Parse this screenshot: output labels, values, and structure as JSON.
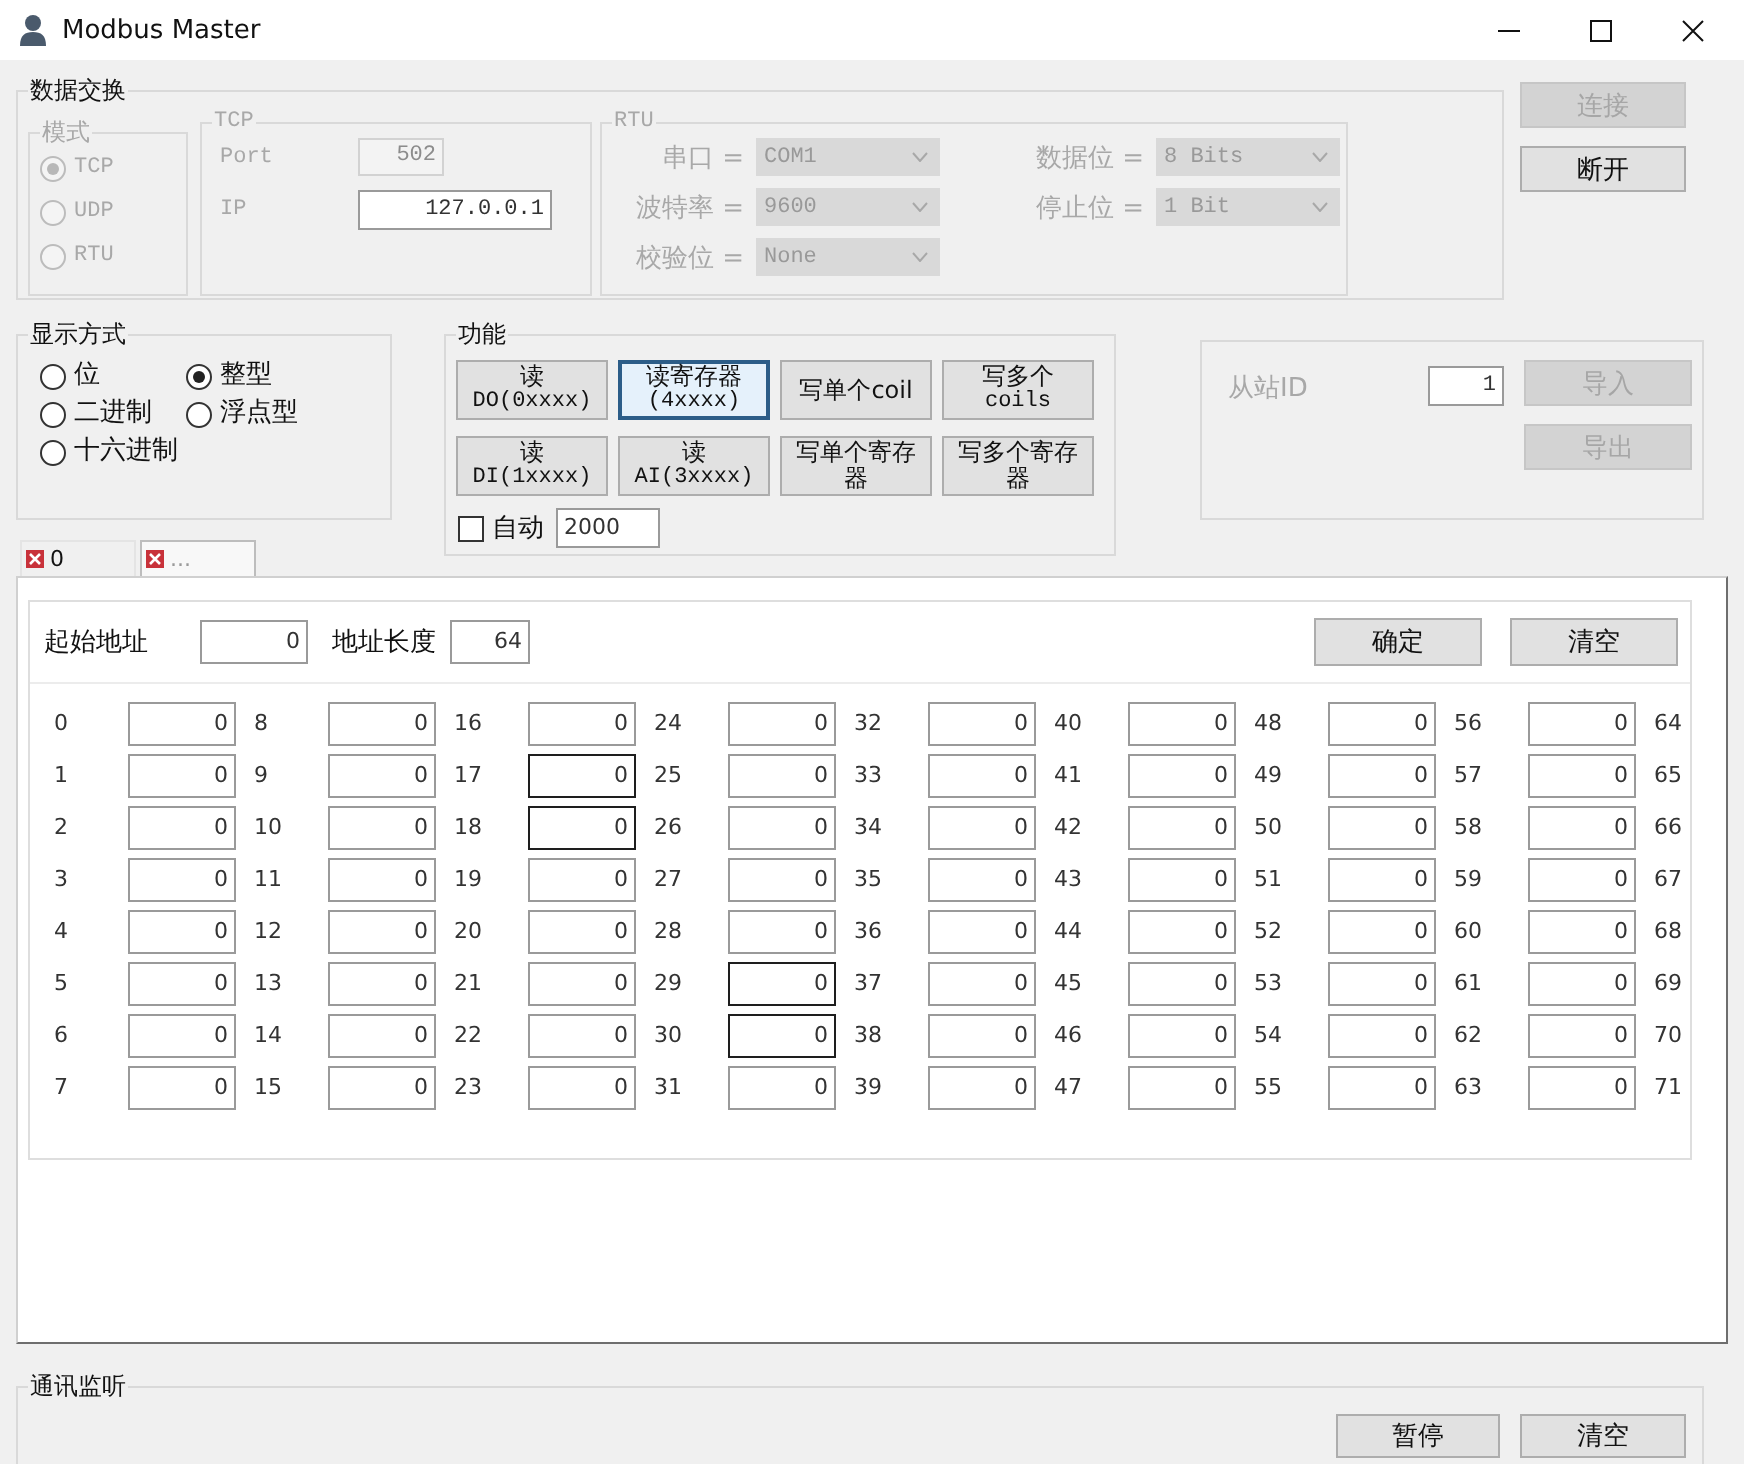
{
  "window": {
    "title": "Modbus Master"
  },
  "data_exchange": {
    "title": "数据交换",
    "mode": {
      "title": "模式",
      "disabled": true,
      "options": [
        {
          "label": "TCP",
          "selected": true
        },
        {
          "label": "UDP",
          "selected": false
        },
        {
          "label": "RTU",
          "selected": false
        }
      ]
    },
    "tcp": {
      "title": "TCP",
      "disabled": true,
      "fields": [
        {
          "label": "Port",
          "value": "502",
          "disabled": true
        },
        {
          "label": "IP",
          "value": "127.0.0.1",
          "disabled": false
        }
      ]
    },
    "rtu": {
      "title": "RTU",
      "disabled": true,
      "fields": [
        {
          "label": "串口 =",
          "value": "COM1"
        },
        {
          "label": "数据位 =",
          "value": "8 Bits"
        },
        {
          "label": "波特率 =",
          "value": "9600"
        },
        {
          "label": "停止位 =",
          "value": "1 Bit"
        },
        {
          "label": "校验位 =",
          "value": "None"
        }
      ]
    },
    "buttons": [
      {
        "label": "连接",
        "disabled": true
      },
      {
        "label": "断开",
        "disabled": false
      }
    ]
  },
  "display_mode": {
    "title": "显示方式",
    "options": [
      {
        "label": "位",
        "selected": false
      },
      {
        "label": "整型",
        "selected": true
      },
      {
        "label": "二进制",
        "selected": false
      },
      {
        "label": "浮点型",
        "selected": false
      },
      {
        "label": "十六进制",
        "selected": false
      }
    ]
  },
  "functions": {
    "title": "功能",
    "buttons": [
      {
        "lines": [
          "读",
          "DO(0xxxx)"
        ],
        "selected": false
      },
      {
        "lines": [
          "读寄存器",
          "(4xxxx)"
        ],
        "selected": true
      },
      {
        "lines": [
          "写单个coil"
        ],
        "selected": false
      },
      {
        "lines": [
          "写多个",
          "coils"
        ],
        "selected": false
      },
      {
        "lines": [
          "读",
          "DI(1xxxx)"
        ],
        "selected": false
      },
      {
        "lines": [
          "读",
          "AI(3xxxx)"
        ],
        "selected": false
      },
      {
        "lines": [
          "写单个寄存器"
        ],
        "selected": false
      },
      {
        "lines": [
          "写多个寄存器"
        ],
        "selected": false
      }
    ],
    "auto": {
      "label": "自动",
      "checked": false
    },
    "interval": "2000"
  },
  "slave": {
    "label": "从站ID",
    "disabled": true,
    "value": "1",
    "buttons": [
      {
        "label": "导入",
        "disabled": true
      },
      {
        "label": "导出",
        "disabled": true
      }
    ]
  },
  "tabs": [
    {
      "label": "0",
      "selected": true
    },
    {
      "label": "...",
      "selected": false
    }
  ],
  "registers": {
    "start_label": "起始地址",
    "start": "0",
    "length_label": "地址长度",
    "length": "64",
    "buttons": [
      {
        "label": "确定"
      },
      {
        "label": "清空"
      }
    ],
    "rows": [
      {
        "labels": [
          "0",
          "8",
          "16",
          "24",
          "32",
          "40",
          "48",
          "56",
          "64"
        ],
        "cells": [
          {
            "value": "0",
            "outlined": false
          },
          {
            "value": "0",
            "outlined": false
          },
          {
            "value": "0",
            "outlined": false
          },
          {
            "value": "0",
            "outlined": false
          },
          {
            "value": "0",
            "outlined": false
          },
          {
            "value": "0",
            "outlined": false
          },
          {
            "value": "0",
            "outlined": false
          },
          {
            "value": "0",
            "outlined": false
          }
        ]
      },
      {
        "labels": [
          "1",
          "9",
          "17",
          "25",
          "33",
          "41",
          "49",
          "57",
          "65"
        ],
        "cells": [
          {
            "value": "0",
            "outlined": false
          },
          {
            "value": "0",
            "outlined": false
          },
          {
            "value": "0",
            "outlined": true
          },
          {
            "value": "0",
            "outlined": false
          },
          {
            "value": "0",
            "outlined": false
          },
          {
            "value": "0",
            "outlined": false
          },
          {
            "value": "0",
            "outlined": false
          },
          {
            "value": "0",
            "outlined": false
          }
        ]
      },
      {
        "labels": [
          "2",
          "10",
          "18",
          "26",
          "34",
          "42",
          "50",
          "58",
          "66"
        ],
        "cells": [
          {
            "value": "0",
            "outlined": false
          },
          {
            "value": "0",
            "outlined": false
          },
          {
            "value": "0",
            "outlined": true
          },
          {
            "value": "0",
            "outlined": false
          },
          {
            "value": "0",
            "outlined": false
          },
          {
            "value": "0",
            "outlined": false
          },
          {
            "value": "0",
            "outlined": false
          },
          {
            "value": "0",
            "outlined": false
          }
        ]
      },
      {
        "labels": [
          "3",
          "11",
          "19",
          "27",
          "35",
          "43",
          "51",
          "59",
          "67"
        ],
        "cells": [
          {
            "value": "0",
            "outlined": false
          },
          {
            "value": "0",
            "outlined": false
          },
          {
            "value": "0",
            "outlined": false
          },
          {
            "value": "0",
            "outlined": false
          },
          {
            "value": "0",
            "outlined": false
          },
          {
            "value": "0",
            "outlined": false
          },
          {
            "value": "0",
            "outlined": false
          },
          {
            "value": "0",
            "outlined": false
          }
        ]
      },
      {
        "labels": [
          "4",
          "12",
          "20",
          "28",
          "36",
          "44",
          "52",
          "60",
          "68"
        ],
        "cells": [
          {
            "value": "0",
            "outlined": false
          },
          {
            "value": "0",
            "outlined": false
          },
          {
            "value": "0",
            "outlined": false
          },
          {
            "value": "0",
            "outlined": false
          },
          {
            "value": "0",
            "outlined": false
          },
          {
            "value": "0",
            "outlined": false
          },
          {
            "value": "0",
            "outlined": false
          },
          {
            "value": "0",
            "outlined": false
          }
        ]
      },
      {
        "labels": [
          "5",
          "13",
          "21",
          "29",
          "37",
          "45",
          "53",
          "61",
          "69"
        ],
        "cells": [
          {
            "value": "0",
            "outlined": false
          },
          {
            "value": "0",
            "outlined": false
          },
          {
            "value": "0",
            "outlined": false
          },
          {
            "value": "0",
            "outlined": true
          },
          {
            "value": "0",
            "outlined": false
          },
          {
            "value": "0",
            "outlined": false
          },
          {
            "value": "0",
            "outlined": false
          },
          {
            "value": "0",
            "outlined": false
          }
        ]
      },
      {
        "labels": [
          "6",
          "14",
          "22",
          "30",
          "38",
          "46",
          "54",
          "62",
          "70"
        ],
        "cells": [
          {
            "value": "0",
            "outlined": false
          },
          {
            "value": "0",
            "outlined": false
          },
          {
            "value": "0",
            "outlined": false
          },
          {
            "value": "0",
            "outlined": true
          },
          {
            "value": "0",
            "outlined": false
          },
          {
            "value": "0",
            "outlined": false
          },
          {
            "value": "0",
            "outlined": false
          },
          {
            "value": "0",
            "outlined": false
          }
        ]
      },
      {
        "labels": [
          "7",
          "15",
          "23",
          "31",
          "39",
          "47",
          "55",
          "63",
          "71"
        ],
        "cells": [
          {
            "value": "0",
            "outlined": false
          },
          {
            "value": "0",
            "outlined": false
          },
          {
            "value": "0",
            "outlined": false
          },
          {
            "value": "0",
            "outlined": false
          },
          {
            "value": "0",
            "outlined": false
          },
          {
            "value": "0",
            "outlined": false
          },
          {
            "value": "0",
            "outlined": false
          },
          {
            "value": "0",
            "outlined": false
          }
        ]
      }
    ]
  },
  "monitor": {
    "title": "通讯监听",
    "buttons": [
      {
        "label": "暂停"
      },
      {
        "label": "清空"
      }
    ]
  }
}
